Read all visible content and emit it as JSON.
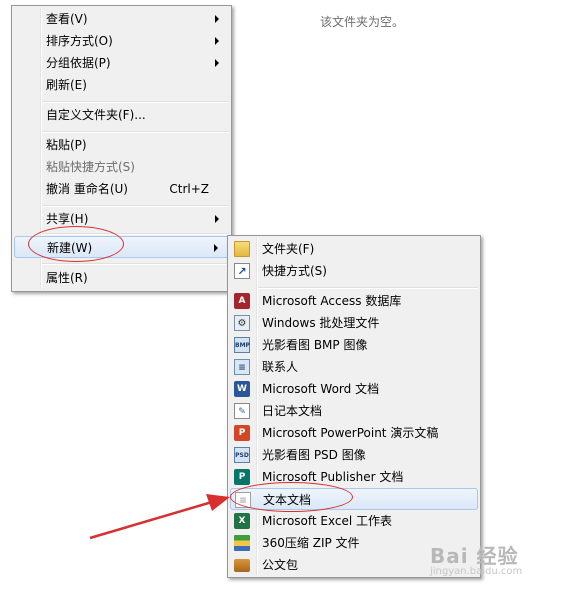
{
  "desktop": {
    "empty_message": "该文件夹为空。"
  },
  "context_menu": {
    "items": [
      {
        "label": "查看(V)",
        "submenu": true
      },
      {
        "label": "排序方式(O)",
        "submenu": true
      },
      {
        "label": "分组依据(P)",
        "submenu": true
      },
      {
        "label": "刷新(E)"
      },
      {
        "label": "自定义文件夹(F)..."
      },
      {
        "label": "粘贴(P)"
      },
      {
        "label": "粘贴快捷方式(S)",
        "disabled": true
      },
      {
        "label": "撤消 重命名(U)",
        "accel": "Ctrl+Z"
      },
      {
        "label": "共享(H)",
        "submenu": true
      },
      {
        "label": "新建(W)",
        "submenu": true,
        "highlighted": true
      },
      {
        "label": "属性(R)"
      }
    ]
  },
  "new_submenu": {
    "items": [
      {
        "label": "文件夹(F)",
        "icon": "folder-icon"
      },
      {
        "label": "快捷方式(S)",
        "icon": "shortcut-icon"
      },
      {
        "label": "Microsoft Access 数据库",
        "icon": "access-icon"
      },
      {
        "label": "Windows 批处理文件",
        "icon": "batch-file-icon"
      },
      {
        "label": "光影看图 BMP 图像",
        "icon": "bmp-image-icon"
      },
      {
        "label": "联系人",
        "icon": "contact-icon"
      },
      {
        "label": "Microsoft Word 文档",
        "icon": "word-icon"
      },
      {
        "label": "日记本文档",
        "icon": "journal-icon"
      },
      {
        "label": "Microsoft PowerPoint 演示文稿",
        "icon": "powerpoint-icon"
      },
      {
        "label": "光影看图 PSD 图像",
        "icon": "psd-image-icon"
      },
      {
        "label": "Microsoft Publisher 文档",
        "icon": "publisher-icon"
      },
      {
        "label": "文本文档",
        "icon": "text-document-icon",
        "highlighted": true
      },
      {
        "label": "Microsoft Excel 工作表",
        "icon": "excel-icon"
      },
      {
        "label": "360压缩 ZIP 文件",
        "icon": "zip-archive-icon"
      },
      {
        "label": "公文包",
        "icon": "briefcase-icon"
      }
    ]
  },
  "watermark": {
    "brand": "Bai 经验",
    "url": "jingyan.baidu.com"
  },
  "colors": {
    "annotation_red": "#d83030",
    "menu_bg": "#f0f0f0",
    "highlight_border": "#a8c8ee"
  }
}
